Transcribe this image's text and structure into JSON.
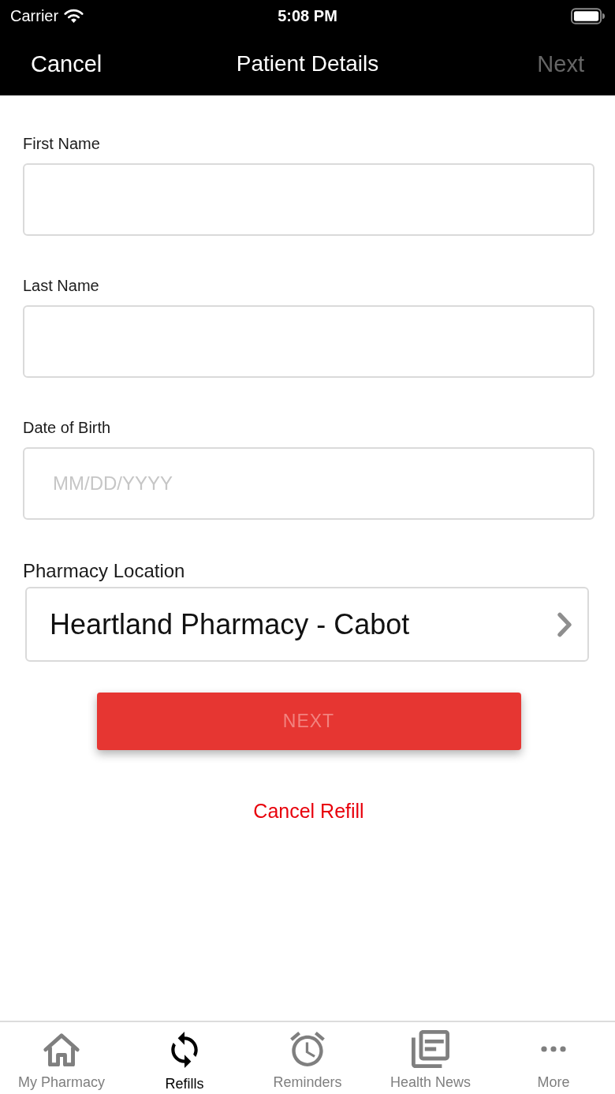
{
  "status_bar": {
    "carrier": "Carrier",
    "time": "5:08 PM"
  },
  "nav_bar": {
    "cancel": "Cancel",
    "title": "Patient Details",
    "next": {
      "label": "Next",
      "disabled": true
    }
  },
  "form": {
    "fields": [
      {
        "kind": "text",
        "label": "First Name"
      },
      {
        "kind": "text",
        "label": "Last Name"
      },
      {
        "kind": "text",
        "label": "Date of Birth",
        "placeholder": "MM/DD/YYYY"
      },
      {
        "kind": "select",
        "label": "Pharmacy Location",
        "value": "Heartland Pharmacy - Cabot"
      }
    ],
    "next_button": {
      "label": "NEXT",
      "disabled": true
    },
    "cancel_link": "Cancel Refill"
  },
  "tab_bar": {
    "tabs": [
      {
        "label": "My Pharmacy",
        "selected": false
      },
      {
        "label": "Refills",
        "selected": true
      },
      {
        "label": "Reminders",
        "selected": false
      },
      {
        "label": "Health News",
        "selected": false
      },
      {
        "label": "More",
        "selected": false
      }
    ]
  }
}
